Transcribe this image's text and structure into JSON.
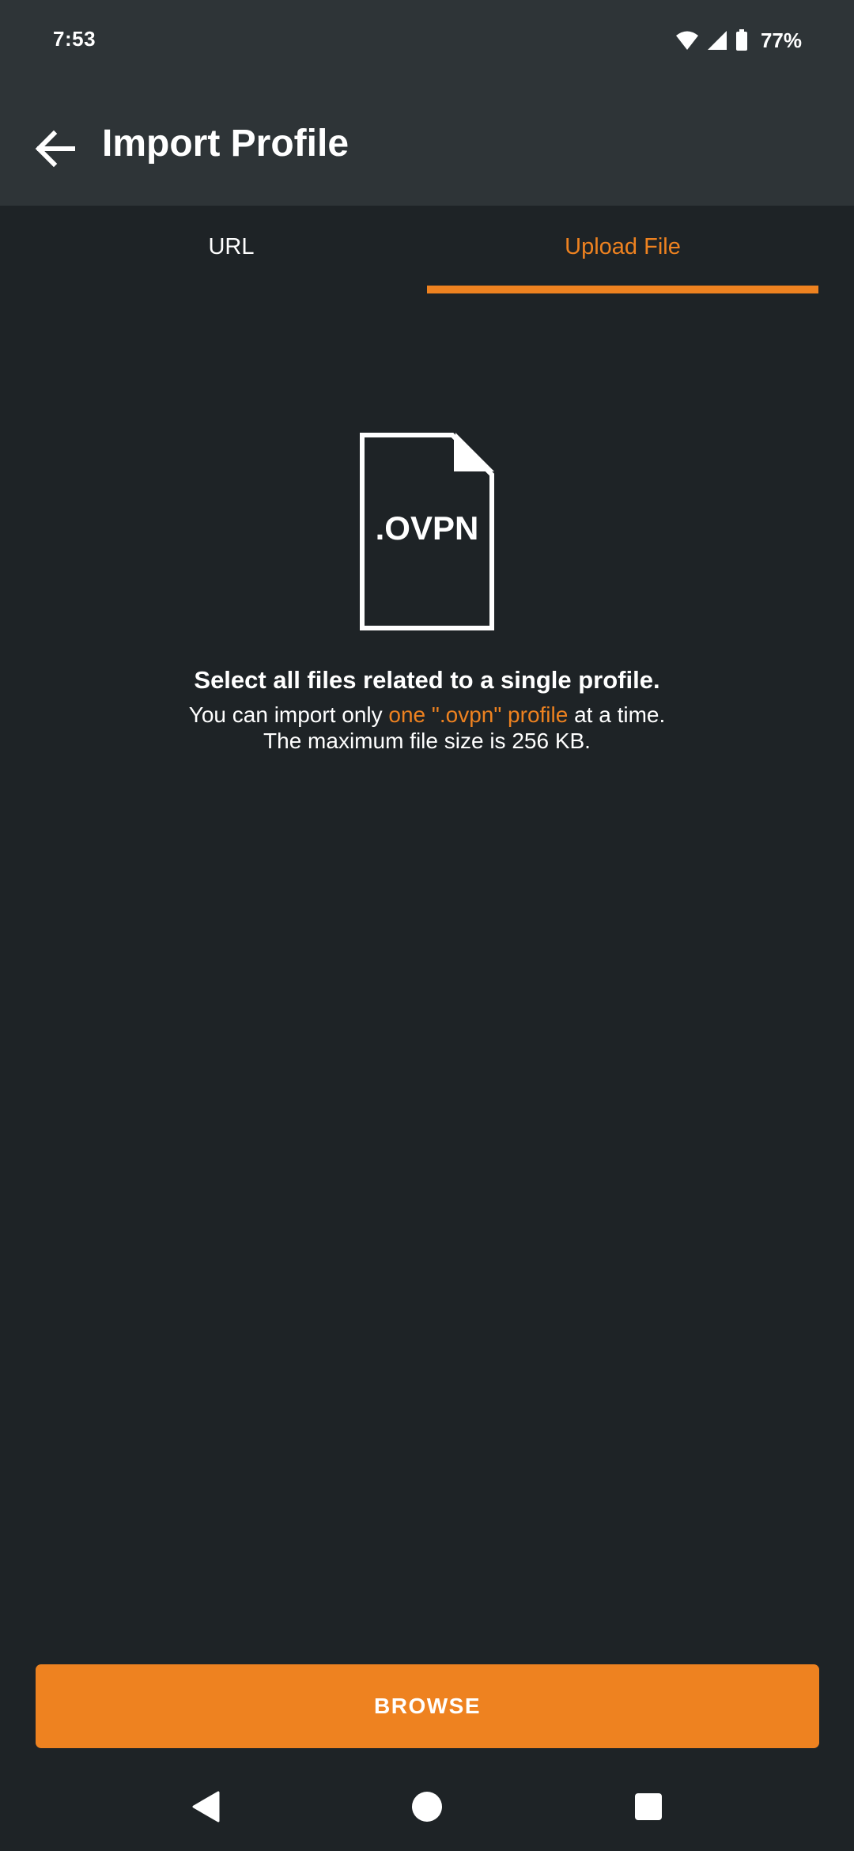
{
  "status_bar": {
    "time": "7:53",
    "battery_percent": "77%",
    "icons": [
      "wifi-icon",
      "cell-signal-icon",
      "battery-icon"
    ]
  },
  "app_bar": {
    "title": "Import Profile",
    "back_icon": "arrow-back-icon"
  },
  "tabs": [
    {
      "label": "URL",
      "selected": false
    },
    {
      "label": "Upload File",
      "selected": true
    }
  ],
  "content": {
    "file_icon_label": ".OVPN",
    "headline": "Select all files related to a single profile.",
    "desc_part1": "You can import only ",
    "desc_highlight": "one \".ovpn\" profile",
    "desc_part2": " at a time.",
    "desc_line2": "The maximum file size is 256 KB."
  },
  "browse_button": {
    "label": "BROWSE"
  },
  "colors": {
    "accent": "#ee8220",
    "app_bar_bg": "#2e3437",
    "page_bg": "#1e2326",
    "text": "#ffffff"
  },
  "nav_bar": {
    "icons": [
      "nav-back-icon",
      "nav-home-icon",
      "nav-recents-icon"
    ]
  }
}
